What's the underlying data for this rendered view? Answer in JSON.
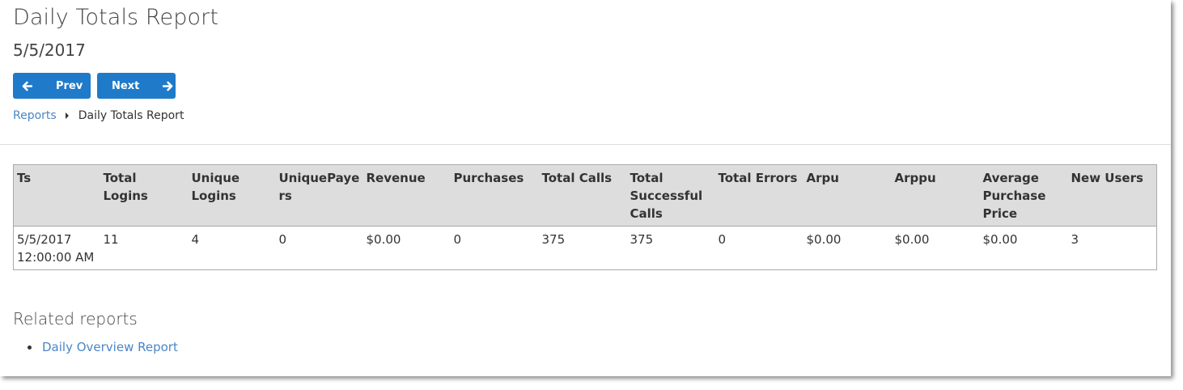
{
  "page": {
    "title": "Daily Totals Report",
    "date": "5/5/2017"
  },
  "nav": {
    "prev_label": "Prev",
    "next_label": "Next",
    "button_color": "#1f7bc9"
  },
  "breadcrumb": {
    "parent": "Reports",
    "current": "Daily Totals Report"
  },
  "table": {
    "headers": [
      "Ts",
      "Total Logins",
      "Unique Logins",
      "UniquePayers",
      "Revenue",
      "Purchases",
      "Total Calls",
      "Total Successful Calls",
      "Total Errors",
      "Arpu",
      "Arppu",
      "Average Purchase Price",
      "New Users"
    ],
    "rows": [
      [
        "5/5/2017 12:00:00 AM",
        "11",
        "4",
        "0",
        "$0.00",
        "0",
        "375",
        "375",
        "0",
        "$0.00",
        "$0.00",
        "$0.00",
        "3"
      ]
    ]
  },
  "related": {
    "title": "Related reports",
    "items": [
      "Daily Overview Report"
    ],
    "link_color": "#4a86c8"
  }
}
